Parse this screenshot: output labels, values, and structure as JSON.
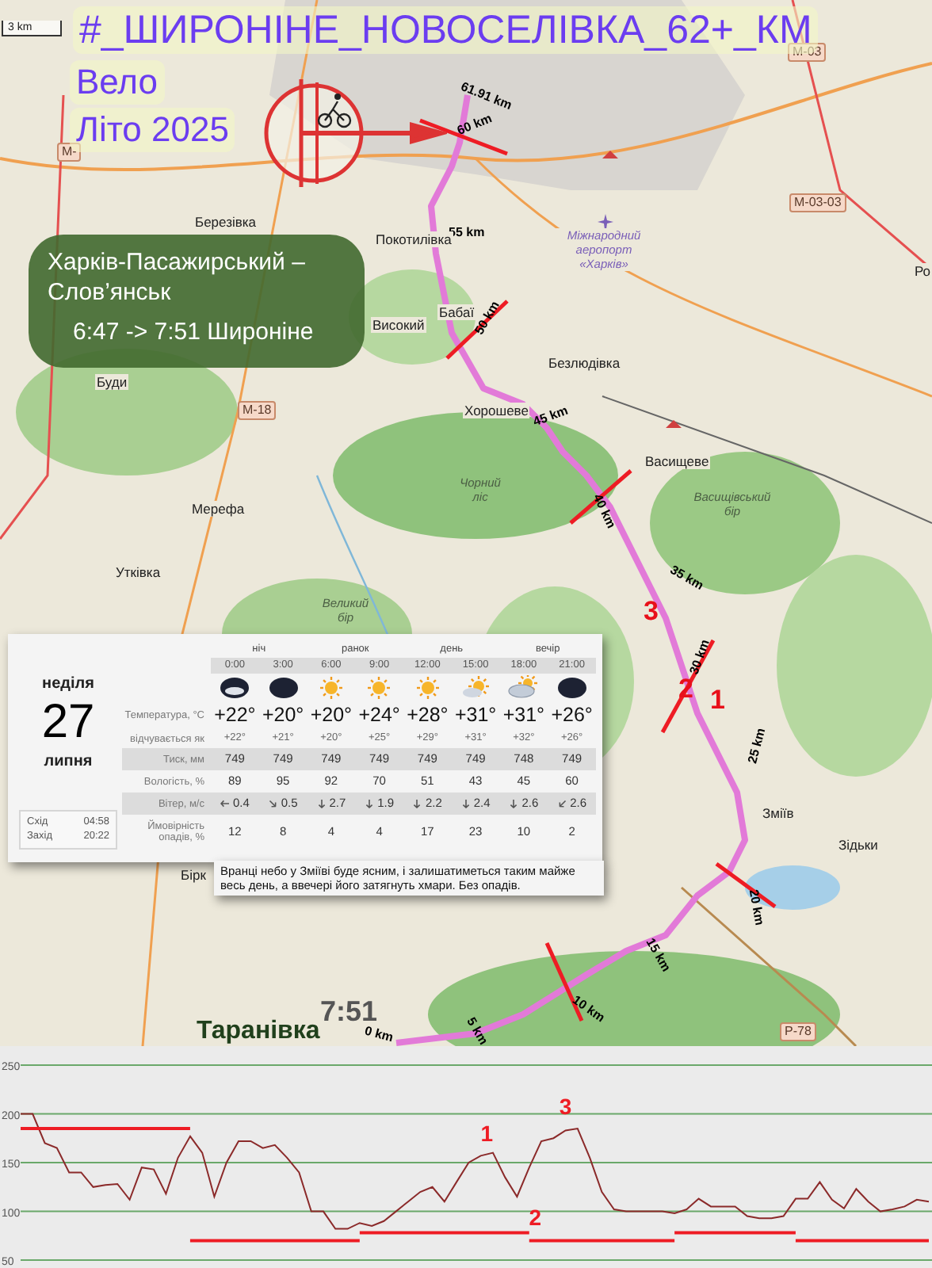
{
  "scale": "3 km",
  "title": "#_ШИРОНІНЕ_НОВОСЕЛІВКА_62+_КМ",
  "subtitle_lines": [
    "Вело",
    "Літо 2025"
  ],
  "train_info": {
    "route": "Харків-Пасажирський – Слов’янськ",
    "time": "6:47 -> 7:51 Широніне"
  },
  "map_labels": [
    {
      "text": "М-03",
      "kind": "road"
    },
    {
      "text": "М-",
      "kind": "road"
    },
    {
      "text": "61.91 km",
      "kind": "km"
    },
    {
      "text": "60 km",
      "kind": "km"
    },
    {
      "text": "М-03-03",
      "kind": "road"
    },
    {
      "text": "55 km",
      "kind": "km"
    },
    {
      "text": "Покотилівка",
      "kind": "town"
    },
    {
      "text": "Міжнародний аеропорт «Харків»",
      "kind": "airport"
    },
    {
      "text": "Ро",
      "kind": "town"
    },
    {
      "text": "Березівка",
      "kind": "town"
    },
    {
      "text": "Буди",
      "kind": "town"
    },
    {
      "text": "Високий",
      "kind": "town"
    },
    {
      "text": "Бабаї",
      "kind": "town"
    },
    {
      "text": "50 km",
      "kind": "km"
    },
    {
      "text": "Безлюдівка",
      "kind": "town"
    },
    {
      "text": "М-18",
      "kind": "road"
    },
    {
      "text": "Хорошеве",
      "kind": "town"
    },
    {
      "text": "45 km",
      "kind": "km"
    },
    {
      "text": "Чорний ліс",
      "kind": "forest"
    },
    {
      "text": "Васищеве",
      "kind": "town"
    },
    {
      "text": "Мерефа",
      "kind": "town"
    },
    {
      "text": "Васищівський бір",
      "kind": "forest"
    },
    {
      "text": "40 km",
      "kind": "km"
    },
    {
      "text": "Утківка",
      "kind": "town"
    },
    {
      "text": "3",
      "kind": "marker"
    },
    {
      "text": "35 km",
      "kind": "km"
    },
    {
      "text": "Великий бір",
      "kind": "forest"
    },
    {
      "text": "30 km",
      "kind": "km"
    },
    {
      "text": "2",
      "kind": "marker"
    },
    {
      "text": "1",
      "kind": "marker"
    },
    {
      "text": "25 km",
      "kind": "km"
    },
    {
      "text": "Зміїв",
      "kind": "town"
    },
    {
      "text": "Зідьки",
      "kind": "town"
    },
    {
      "text": "Бірк",
      "kind": "town"
    },
    {
      "text": "20 km",
      "kind": "km"
    },
    {
      "text": "15 km",
      "kind": "km"
    },
    {
      "text": "10 km",
      "kind": "km"
    },
    {
      "text": "7:51",
      "kind": "arrival"
    },
    {
      "text": "Таранівка",
      "kind": "village"
    },
    {
      "text": "0 km",
      "kind": "km"
    },
    {
      "text": "5 km",
      "kind": "km"
    },
    {
      "text": "Р-78",
      "kind": "road"
    }
  ],
  "weather": {
    "weekday": "неділя",
    "day": "27",
    "month": "липня",
    "sun": [
      {
        "label": "Схід",
        "time": "04:58"
      },
      {
        "label": "Захід",
        "time": "20:22"
      }
    ],
    "periods": [
      "ніч",
      "ранок",
      "день",
      "вечір"
    ],
    "row_labels": {
      "temp": "Температура, °C",
      "feels": "відчувається як",
      "pressure": "Тиск, мм",
      "humidity": "Вологість, %",
      "wind": "Вітер, м/с",
      "precip": "Ймовірність опадів, %"
    },
    "hours": [
      {
        "time": "0:00",
        "kind": "cloudy-night",
        "temp": "+22°",
        "feels": "+22°",
        "pressure": "749",
        "humidity": "89",
        "wind": {
          "kind": "w",
          "value": "0.4"
        },
        "precip": "12"
      },
      {
        "time": "3:00",
        "kind": "moon",
        "temp": "+20°",
        "feels": "+21°",
        "pressure": "749",
        "humidity": "95",
        "wind": {
          "kind": "se",
          "value": "0.5"
        },
        "precip": "8"
      },
      {
        "time": "6:00",
        "kind": "sun",
        "temp": "+20°",
        "feels": "+20°",
        "pressure": "749",
        "humidity": "92",
        "wind": {
          "kind": "s",
          "value": "2.7"
        },
        "precip": "4"
      },
      {
        "time": "9:00",
        "kind": "sun",
        "temp": "+24°",
        "feels": "+25°",
        "pressure": "749",
        "humidity": "70",
        "wind": {
          "kind": "s",
          "value": "1.9"
        },
        "precip": "4"
      },
      {
        "time": "12:00",
        "kind": "sun",
        "temp": "+28°",
        "feels": "+29°",
        "pressure": "749",
        "humidity": "51",
        "wind": {
          "kind": "s",
          "value": "2.2"
        },
        "precip": "17"
      },
      {
        "time": "15:00",
        "kind": "sun-cloud",
        "temp": "+31°",
        "feels": "+31°",
        "pressure": "749",
        "humidity": "43",
        "wind": {
          "kind": "s",
          "value": "2.4"
        },
        "precip": "23"
      },
      {
        "time": "18:00",
        "kind": "cloud-sun",
        "temp": "+31°",
        "feels": "+32°",
        "pressure": "748",
        "humidity": "45",
        "wind": {
          "kind": "s",
          "value": "2.6"
        },
        "precip": "10"
      },
      {
        "time": "21:00",
        "kind": "moon",
        "temp": "+26°",
        "feels": "+26°",
        "pressure": "749",
        "humidity": "60",
        "wind": {
          "kind": "sw",
          "value": "2.6"
        },
        "precip": "2"
      }
    ],
    "description": "Вранці небо у Зміїві буде ясним, і залишатиметься таким майже весь день, а ввечері його затягнуть хмари. Без опадів."
  },
  "elevation": {
    "chart_data": {
      "type": "line",
      "ylim": [
        50,
        250
      ],
      "yticks": [
        50,
        100,
        150,
        200,
        250
      ],
      "grid": true,
      "values": [
        200,
        200,
        170,
        165,
        140,
        140,
        125,
        127,
        128,
        112,
        145,
        143,
        118,
        155,
        177,
        160,
        115,
        150,
        172,
        172,
        165,
        168,
        155,
        140,
        100,
        100,
        82,
        82,
        88,
        85,
        90,
        100,
        110,
        120,
        125,
        110,
        130,
        150,
        157,
        160,
        135,
        115,
        145,
        172,
        175,
        183,
        185,
        155,
        120,
        102,
        100,
        100,
        100,
        100,
        98,
        102,
        113,
        105,
        105,
        105,
        95,
        93,
        93,
        95,
        113,
        113,
        130,
        112,
        103,
        123,
        110,
        100,
        102,
        105,
        112,
        110
      ],
      "annotations": [
        "1",
        "3",
        "2"
      ]
    }
  }
}
